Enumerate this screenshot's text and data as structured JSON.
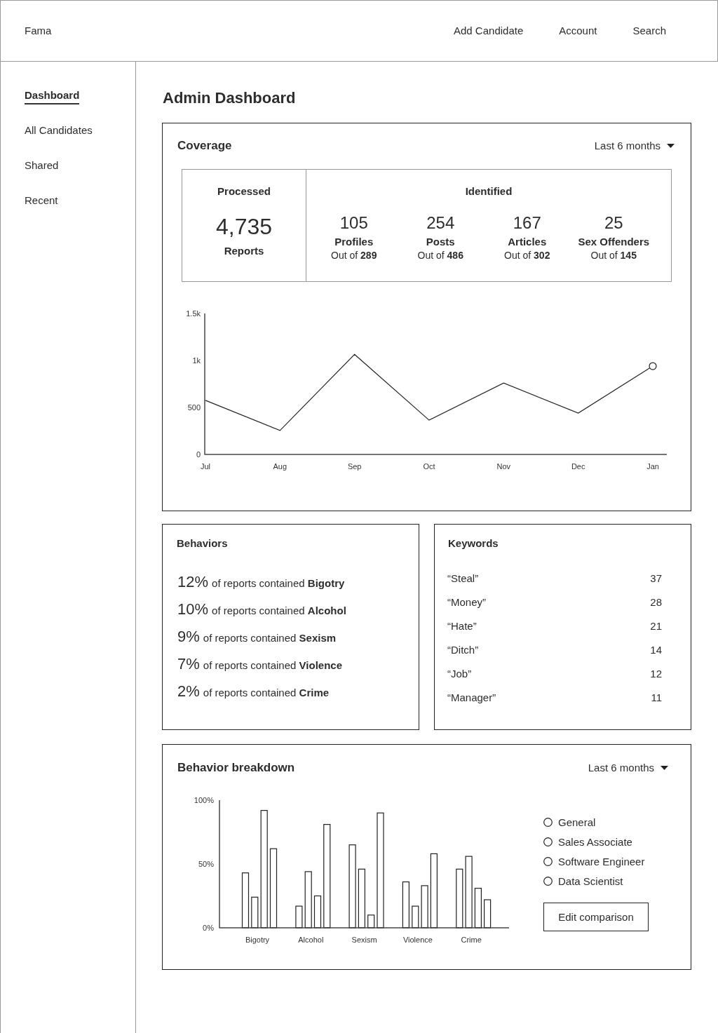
{
  "header": {
    "logo": "Fama",
    "nav": [
      "Add Candidate",
      "Account",
      "Search"
    ]
  },
  "sidebar": {
    "items": [
      {
        "label": "Dashboard",
        "selected": true
      },
      {
        "label": "All Candidates",
        "selected": false
      },
      {
        "label": "Shared",
        "selected": false
      },
      {
        "label": "Recent",
        "selected": false
      }
    ]
  },
  "page_title": "Admin Dashboard",
  "coverage": {
    "title": "Coverage",
    "period": "Last 6 months",
    "processed": {
      "title": "Processed",
      "value": "4,735",
      "label": "Reports"
    },
    "identified": {
      "title": "Identified",
      "items": [
        {
          "value": "105",
          "label": "Profiles",
          "total": "Out of **289**"
        },
        {
          "value": "254",
          "label": "Posts",
          "total": "Out of **486**"
        },
        {
          "value": "167",
          "label": "Articles",
          "total": "Out of **302**"
        },
        {
          "value": "25",
          "label": "Sex Offenders",
          "total": "Out of **145**"
        }
      ]
    },
    "chart_data": {
      "type": "line",
      "categories": [
        "Jul",
        "Aug",
        "Sep",
        "Oct",
        "Nov",
        "Dec",
        "Jan"
      ],
      "values": [
        575,
        255,
        1065,
        365,
        760,
        440,
        940
      ],
      "ylim": [
        0,
        1500
      ],
      "yticks": [
        0,
        500,
        {
          "value": 1000,
          "label": "1k"
        },
        {
          "value": 1500,
          "label": "1.5k"
        }
      ],
      "annotations": [
        {
          "x": "Jan"
        }
      ]
    }
  },
  "behaviors": {
    "title": "Behaviors",
    "items": [
      {
        "percent": "12%",
        "text": "of reports contained **Bigotry**"
      },
      {
        "percent": "10%",
        "text": "of reports contained **Alcohol**"
      },
      {
        "percent": "9%",
        "text": "of reports contained **Sexism**"
      },
      {
        "percent": "7%",
        "text": "of reports contained **Violence**"
      },
      {
        "percent": "2%",
        "text": "of reports contained **Crime**"
      }
    ]
  },
  "keywords": {
    "title": "Keywords",
    "items": [
      {
        "keyword": "“Steal”",
        "count": "37"
      },
      {
        "keyword": "“Money”",
        "count": "28"
      },
      {
        "keyword": "“Hate”",
        "count": "21"
      },
      {
        "keyword": "“Ditch”",
        "count": "14"
      },
      {
        "keyword": "“Job”",
        "count": "12"
      },
      {
        "keyword": "“Manager”",
        "count": "11"
      }
    ]
  },
  "breakdown": {
    "title": "Behavior breakdown",
    "period": "Last 6 months",
    "chart_data": {
      "type": "bar",
      "categories": [
        "Bigotry",
        "Alcohol",
        "Sexism",
        "Violence",
        "Crime"
      ],
      "series": [
        {
          "color": "#ffffff",
          "values": [
            0.43,
            0.17,
            0.65,
            0.36,
            0.46
          ]
        },
        {
          "color": "#ffffff",
          "values": [
            0.24,
            0.44,
            0.46,
            0.17,
            0.56
          ]
        },
        {
          "color": "#ffffff",
          "values": [
            0.92,
            0.25,
            0.1,
            0.33,
            0.31
          ]
        },
        {
          "color": "#ffffff",
          "values": [
            0.62,
            0.81,
            0.9,
            0.58,
            0.22
          ]
        }
      ],
      "stacked": false,
      "ylim": [
        0,
        1
      ],
      "yticks": [
        {
          "value": 0,
          "label": "0%"
        },
        {
          "value": 0.5,
          "label": "50%"
        },
        {
          "value": 1,
          "label": "100%"
        }
      ]
    },
    "options": [
      {
        "label": "General",
        "selected": false
      },
      {
        "label": "Sales Associate",
        "selected": false
      },
      {
        "label": "Software Engineer",
        "selected": false
      },
      {
        "label": "Data Scientist",
        "selected": false
      }
    ],
    "button": "Edit comparison"
  }
}
